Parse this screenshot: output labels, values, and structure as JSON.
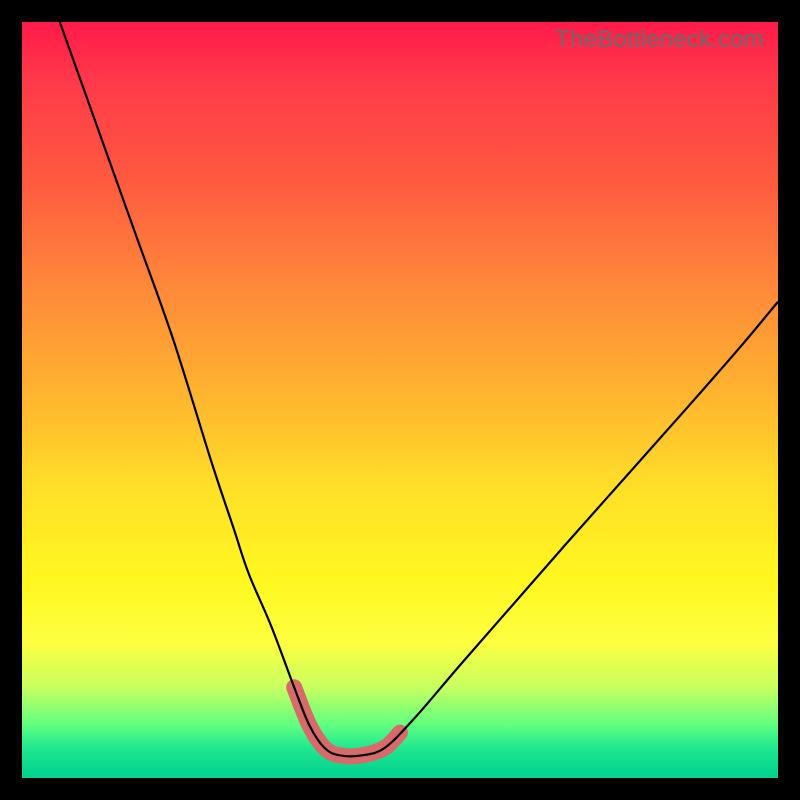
{
  "watermark": "TheBottleneck.com",
  "chart_data": {
    "type": "line",
    "title": "",
    "xlabel": "",
    "ylabel": "",
    "xlim": [
      0,
      100
    ],
    "ylim": [
      0,
      100
    ],
    "series": [
      {
        "name": "bottleneck-curve",
        "x": [
          5,
          10,
          15,
          20,
          25,
          28,
          30,
          33,
          36,
          38,
          40,
          42,
          45,
          48,
          52,
          58,
          65,
          72,
          80,
          88,
          95,
          100
        ],
        "values": [
          100,
          86,
          72,
          58,
          42,
          33,
          27,
          20,
          12,
          7,
          4,
          3,
          3,
          4,
          8,
          15,
          23,
          31,
          40,
          49,
          57,
          63
        ]
      }
    ],
    "highlight": {
      "note": "flattened valley segment drawn with thick pink stroke",
      "x": [
        36,
        38,
        40,
        42,
        45,
        48,
        50
      ],
      "values": [
        12,
        7,
        4,
        3,
        3,
        4,
        6
      ]
    },
    "grid": false,
    "legend": false
  }
}
